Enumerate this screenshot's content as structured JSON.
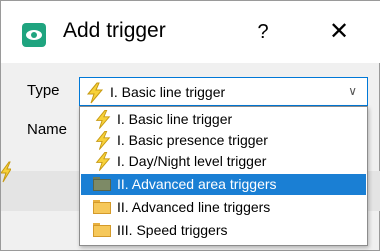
{
  "window": {
    "title": "Add trigger",
    "help_label": "?",
    "close_label": "✕",
    "accent": "#1fa47f"
  },
  "form": {
    "type_label": "Type",
    "name_label": "Name",
    "selected_value": "I. Basic line trigger"
  },
  "dropdown": {
    "options": [
      {
        "label": "I. Basic line trigger",
        "icon": "lightning-icon"
      },
      {
        "label": "I. Basic presence trigger",
        "icon": "lightning-icon"
      },
      {
        "label": "I. Day/Night level trigger",
        "icon": "lightning-icon"
      },
      {
        "label": "II. Advanced area triggers",
        "icon": "folder-icon",
        "selected": true
      },
      {
        "label": "II. Advanced line triggers",
        "icon": "folder-icon"
      },
      {
        "label": "III. Speed triggers",
        "icon": "folder-icon"
      }
    ],
    "highlight_color": "#1a7fd4"
  }
}
